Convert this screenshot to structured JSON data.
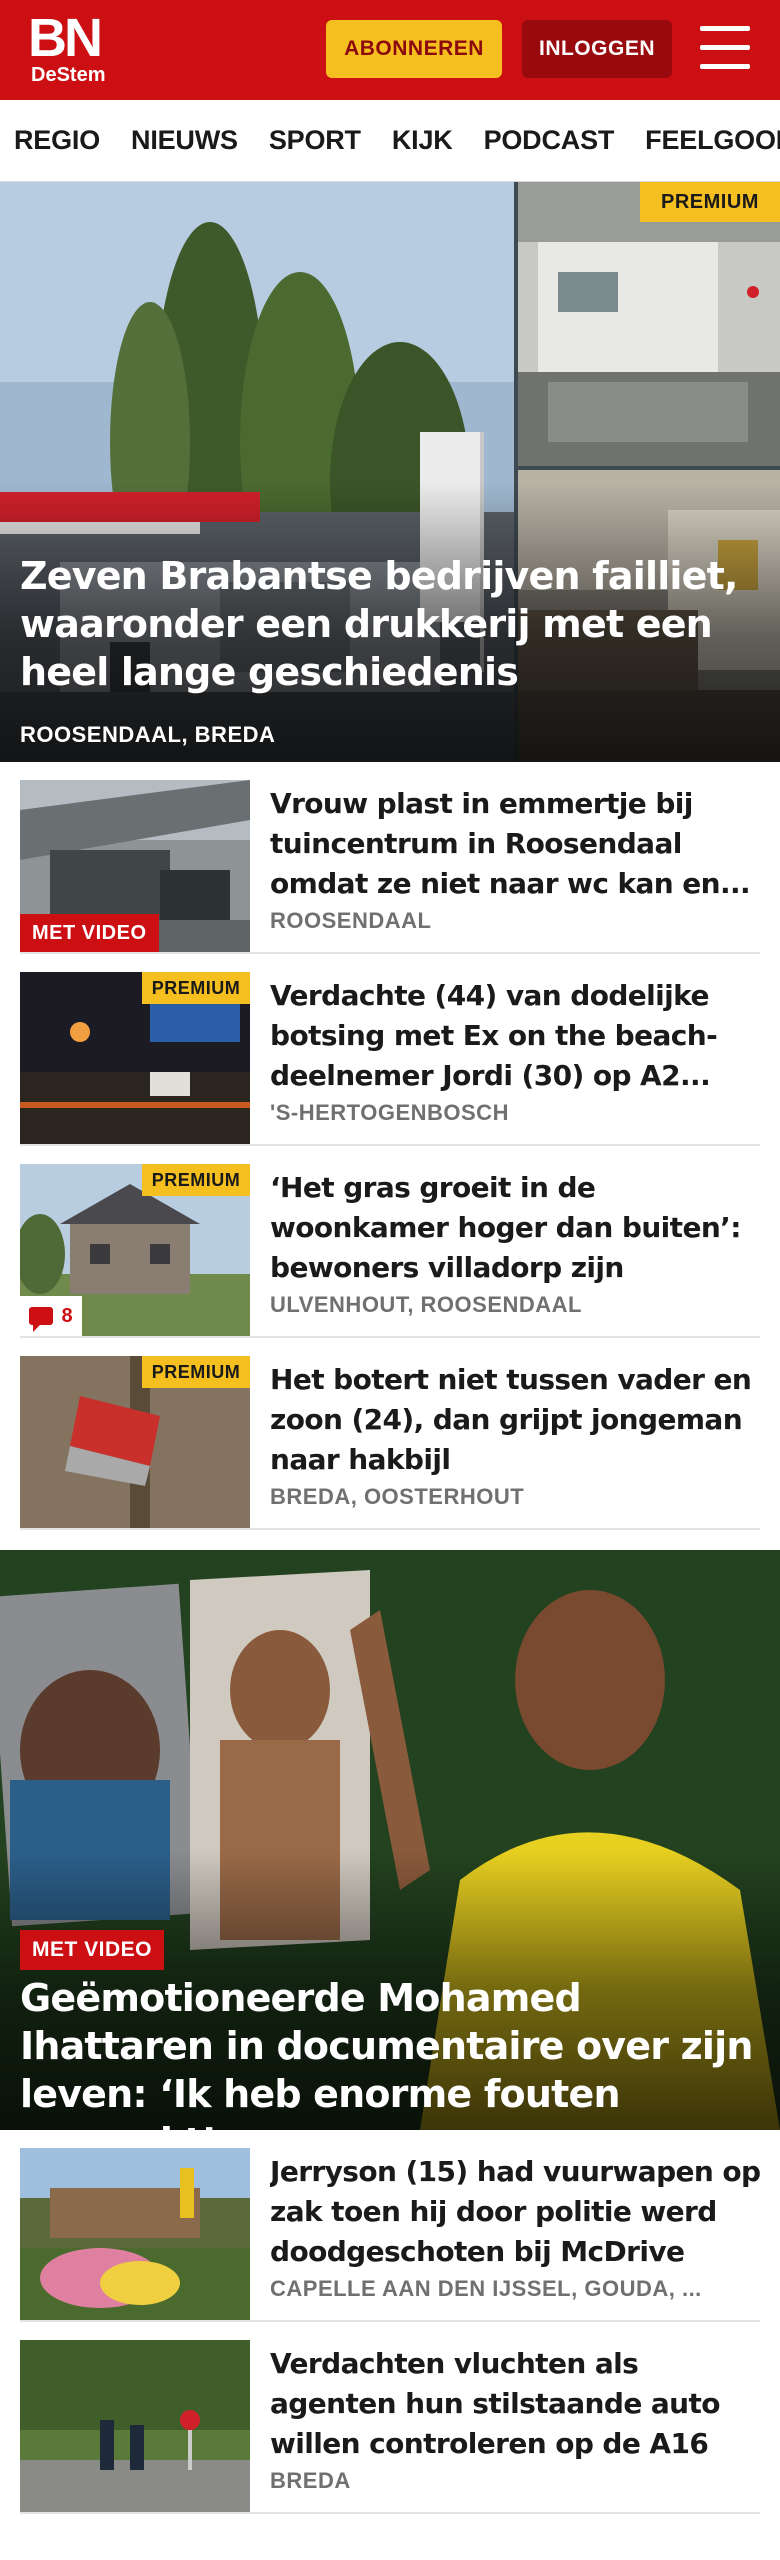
{
  "header": {
    "logo_main": "BN",
    "logo_sub": "DeStem",
    "subscribe_label": "ABONNEREN",
    "login_label": "INLOGGEN",
    "brand_color": "#cc0f13",
    "accent_color": "#f5bf1f"
  },
  "nav": {
    "items": [
      "REGIO",
      "NIEUWS",
      "SPORT",
      "KIJK",
      "PODCAST",
      "FEELGOOD"
    ]
  },
  "hero": {
    "title": "Zeven Brabantse bedrijven failliet, waaronder een drukkerij met een heel lange geschiedenis",
    "location": "ROOSENDAAL, BREDA",
    "premium": "PREMIUM"
  },
  "articles": [
    {
      "title": "Vrouw plast in emmertje bij tuincentrum in Roosendaal omdat ze niet naar wc kan en...",
      "location": "ROOSENDAAL",
      "badge": "MET VIDEO"
    },
    {
      "title": "Verdachte (44) van dodelijke botsing met Ex on the beach-deelnemer Jordi (30) op A2...",
      "location": "'S-HERTOGENBOSCH",
      "premium": "PREMIUM"
    },
    {
      "title": "‘Het gras groeit in de woonkamer hoger dan buiten’: bewoners villadorp zijn verloederde woni...",
      "location": "ULVENHOUT, ROOSENDAAL",
      "premium": "PREMIUM",
      "comments": "8"
    },
    {
      "title": "Het botert niet tussen vader en zoon (24), dan grijpt jongeman naar hakbijl",
      "location": "BREDA, OOSTERHOUT",
      "premium": "PREMIUM"
    }
  ],
  "feature": {
    "badge": "MET VIDEO",
    "title": "Geëmotioneerde Mohamed Ihattaren in documentaire over zijn leven: ‘Ik heb enorme fouten gemaakt’"
  },
  "articles2": [
    {
      "title": "Jerryson (15) had vuurwapen op zak toen hij door politie werd doodgeschoten bij McDrive",
      "location": "CAPELLE AAN DEN IJSSEL, GOUDA, ..."
    },
    {
      "title": "Verdachten vluchten als agenten hun stilstaande auto willen controleren op de A16",
      "location": "BREDA"
    }
  ]
}
